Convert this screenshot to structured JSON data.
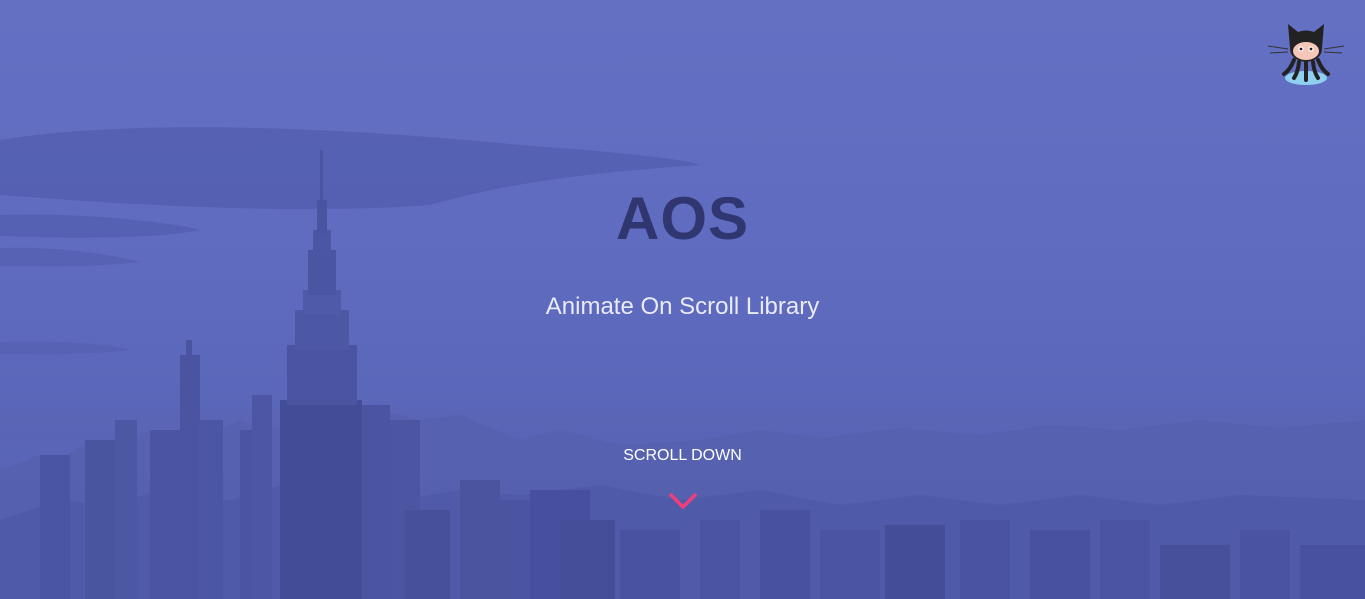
{
  "hero": {
    "title": "AOS",
    "subtitle": "Animate On Scroll Library",
    "scroll_label": "SCROLL DOWN"
  },
  "icons": {
    "github": "github-octocat-icon",
    "scroll": "chevron-down-icon"
  },
  "colors": {
    "overlay": "#5d69bd",
    "title": "#2f3670",
    "subtitle": "#e9ebf7",
    "accent": "#ef3e7a"
  }
}
